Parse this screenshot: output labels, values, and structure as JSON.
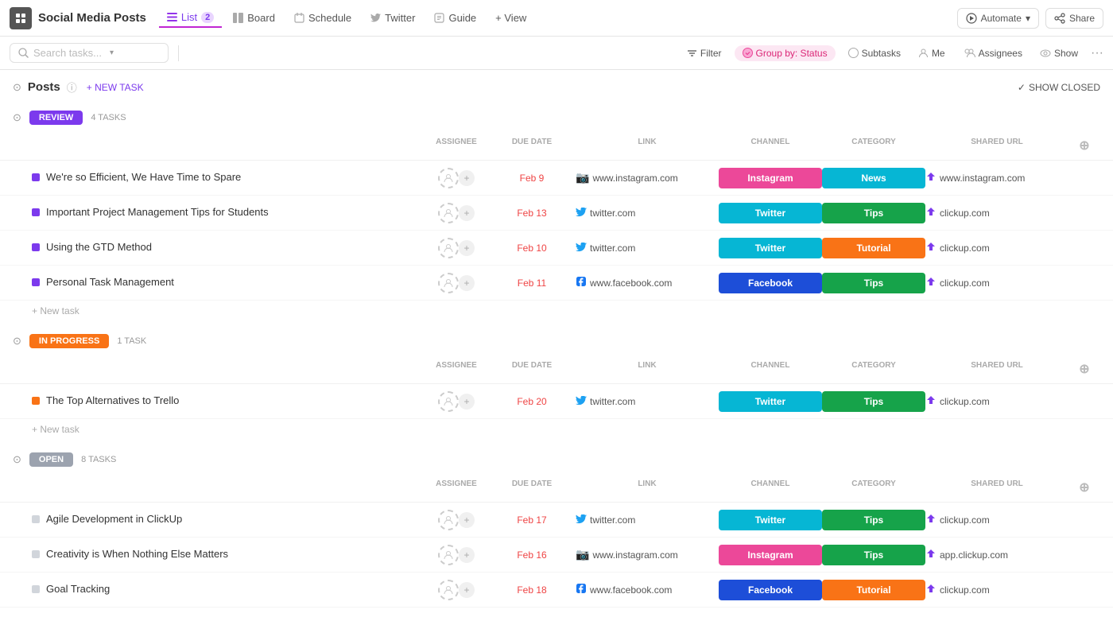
{
  "app": {
    "icon": "☰",
    "title": "Social Media Posts"
  },
  "nav": {
    "tabs": [
      {
        "id": "list",
        "label": "List",
        "icon": "☰",
        "count": "2",
        "active": true
      },
      {
        "id": "board",
        "label": "Board",
        "icon": "⊞",
        "active": false
      },
      {
        "id": "schedule",
        "label": "Schedule",
        "icon": "📅",
        "active": false
      },
      {
        "id": "twitter",
        "label": "Twitter",
        "icon": "</>",
        "active": false
      },
      {
        "id": "guide",
        "label": "Guide",
        "icon": "☰",
        "active": false
      }
    ],
    "view_btn": "+ View",
    "automate_btn": "Automate",
    "share_btn": "Share"
  },
  "toolbar": {
    "search_placeholder": "Search tasks...",
    "filter_btn": "Filter",
    "group_by_btn": "Group by: Status",
    "subtasks_btn": "Subtasks",
    "me_btn": "Me",
    "assignees_btn": "Assignees",
    "show_btn": "Show"
  },
  "posts_section": {
    "title": "Posts",
    "new_task_label": "+ NEW TASK",
    "show_closed_label": "SHOW CLOSED"
  },
  "groups": [
    {
      "id": "review",
      "status": "REVIEW",
      "status_class": "review",
      "task_count": "4 TASKS",
      "columns": [
        "ASSIGNEE",
        "DUE DATE",
        "LINK",
        "CHANNEL",
        "CATEGORY",
        "SHARED URL"
      ],
      "tasks": [
        {
          "name": "We're so Efficient, We Have Time to Spare",
          "dot_class": "purple",
          "due_date": "Feb 9",
          "link_icon": "📷",
          "link_text": "www.instagram.com",
          "channel": "Instagram",
          "channel_class": "instagram",
          "category": "News",
          "category_class": "news",
          "shared_icon": "↑",
          "shared_url": "www.instagram.com"
        },
        {
          "name": "Important Project Management Tips for Students",
          "dot_class": "purple",
          "due_date": "Feb 13",
          "link_icon": "🐦",
          "link_text": "twitter.com",
          "channel": "Twitter",
          "channel_class": "twitter",
          "category": "Tips",
          "category_class": "tips",
          "shared_icon": "↑",
          "shared_url": "clickup.com"
        },
        {
          "name": "Using the GTD Method",
          "dot_class": "purple",
          "due_date": "Feb 10",
          "link_icon": "🐦",
          "link_text": "twitter.com",
          "channel": "Twitter",
          "channel_class": "twitter",
          "category": "Tutorial",
          "category_class": "tutorial",
          "shared_icon": "↑",
          "shared_url": "clickup.com"
        },
        {
          "name": "Personal Task Management",
          "dot_class": "purple",
          "due_date": "Feb 11",
          "link_icon": "📘",
          "link_text": "www.facebook.com",
          "channel": "Facebook",
          "channel_class": "facebook",
          "category": "Tips",
          "category_class": "tips",
          "shared_icon": "↑",
          "shared_url": "clickup.com"
        }
      ]
    },
    {
      "id": "in-progress",
      "status": "IN PROGRESS",
      "status_class": "in-progress",
      "task_count": "1 TASK",
      "columns": [
        "ASSIGNEE",
        "DUE DATE",
        "LINK",
        "CHANNEL",
        "CATEGORY",
        "SHARED URL"
      ],
      "tasks": [
        {
          "name": "The Top Alternatives to Trello",
          "dot_class": "orange",
          "due_date": "Feb 20",
          "link_icon": "🐦",
          "link_text": "twitter.com",
          "channel": "Twitter",
          "channel_class": "twitter",
          "category": "Tips",
          "category_class": "tips",
          "shared_icon": "↑",
          "shared_url": "clickup.com"
        }
      ]
    },
    {
      "id": "open",
      "status": "OPEN",
      "status_class": "open",
      "task_count": "8 TASKS",
      "columns": [
        "ASSIGNEE",
        "DUE DATE",
        "LINK",
        "CHANNEL",
        "CATEGORY",
        "SHARED URL"
      ],
      "tasks": [
        {
          "name": "Agile Development in ClickUp",
          "dot_class": "gray",
          "due_date": "Feb 17",
          "link_icon": "🐦",
          "link_text": "twitter.com",
          "channel": "Twitter",
          "channel_class": "twitter",
          "category": "Tips",
          "category_class": "tips",
          "shared_icon": "↑",
          "shared_url": "clickup.com"
        },
        {
          "name": "Creativity is When Nothing Else Matters",
          "dot_class": "gray",
          "due_date": "Feb 16",
          "link_icon": "📷",
          "link_text": "www.instagram.com",
          "channel": "Instagram",
          "channel_class": "instagram",
          "category": "Tips",
          "category_class": "tips",
          "shared_icon": "↑",
          "shared_url": "app.clickup.com"
        },
        {
          "name": "Goal Tracking",
          "dot_class": "gray",
          "due_date": "Feb 18",
          "link_icon": "📘",
          "link_text": "www.facebook.com",
          "channel": "Facebook",
          "channel_class": "facebook",
          "category": "Tutorial",
          "category_class": "tutorial",
          "shared_icon": "↑",
          "shared_url": "clickup.com"
        }
      ]
    }
  ],
  "icons": {
    "collapse": "⊙",
    "info": "ⓘ",
    "checkmark": "✓",
    "plus": "+",
    "chevron_down": "▾",
    "search": "🔍",
    "filter": "⚡",
    "list": "≡",
    "board": "⊞",
    "schedule": "📅",
    "automate": "⚙",
    "share": "⊕",
    "more": "···",
    "user": "👤"
  }
}
